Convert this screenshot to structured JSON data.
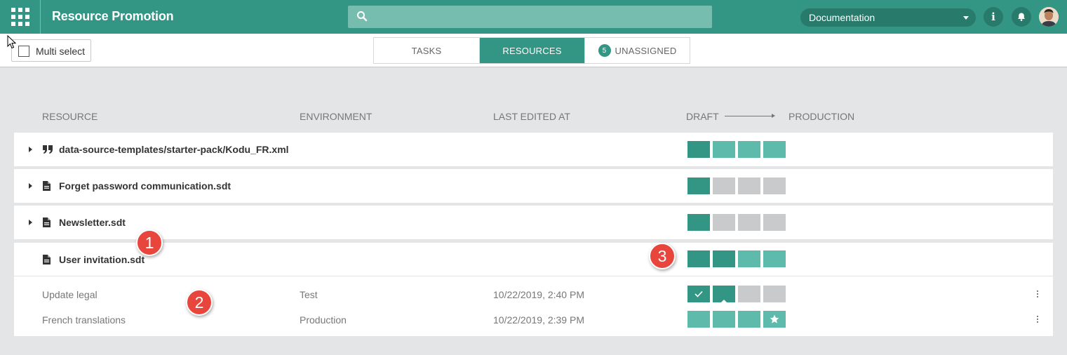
{
  "header": {
    "title": "Resource Promotion",
    "search_placeholder": "",
    "environment": "Documentation",
    "info_icon": "info-icon",
    "bell_icon": "bell-icon"
  },
  "toolbar": {
    "multi_select_label": "Multi select",
    "tabs": [
      {
        "label": "TASKS"
      },
      {
        "label": "RESOURCES"
      },
      {
        "label": "UNASSIGNED",
        "count": "5"
      }
    ],
    "active_tab": "RESOURCES"
  },
  "table": {
    "columns": {
      "resource": "RESOURCE",
      "environment": "ENVIRONMENT",
      "last_edited": "LAST EDITED AT",
      "draft": "DRAFT",
      "production": "PRODUCTION"
    },
    "resources": [
      {
        "name": "data-source-templates/starter-pack/Kodu_FR.xml",
        "icon": "quote-icon",
        "stages": [
          "dark",
          "light",
          "light",
          "light"
        ]
      },
      {
        "name": "Forget password communication.sdt",
        "icon": "document-icon",
        "stages": [
          "dark",
          "gray",
          "gray",
          "gray"
        ]
      },
      {
        "name": "Newsletter.sdt",
        "icon": "document-icon",
        "stages": [
          "dark",
          "gray",
          "gray",
          "gray"
        ]
      },
      {
        "name": "User invitation.sdt",
        "icon": "document-icon",
        "expanded": true,
        "stages": [
          "dark",
          "dark",
          "light",
          "light"
        ]
      }
    ],
    "sub_rows": [
      {
        "name": "Update legal",
        "environment": "Test",
        "edited": "10/22/2019, 2:40 PM",
        "stages": [
          "check",
          "dark-selected",
          "gray",
          "gray"
        ]
      },
      {
        "name": "French translations",
        "environment": "Production",
        "edited": "10/22/2019, 2:39 PM",
        "stages": [
          "light",
          "light",
          "light",
          "star"
        ]
      }
    ]
  },
  "callouts": [
    "1",
    "2",
    "3"
  ],
  "colors": {
    "brand": "#339684",
    "brand_dark": "#287a6b",
    "stage_light": "#5ebaaa",
    "stage_gray": "#c9cacc",
    "callout": "#e8453c"
  }
}
